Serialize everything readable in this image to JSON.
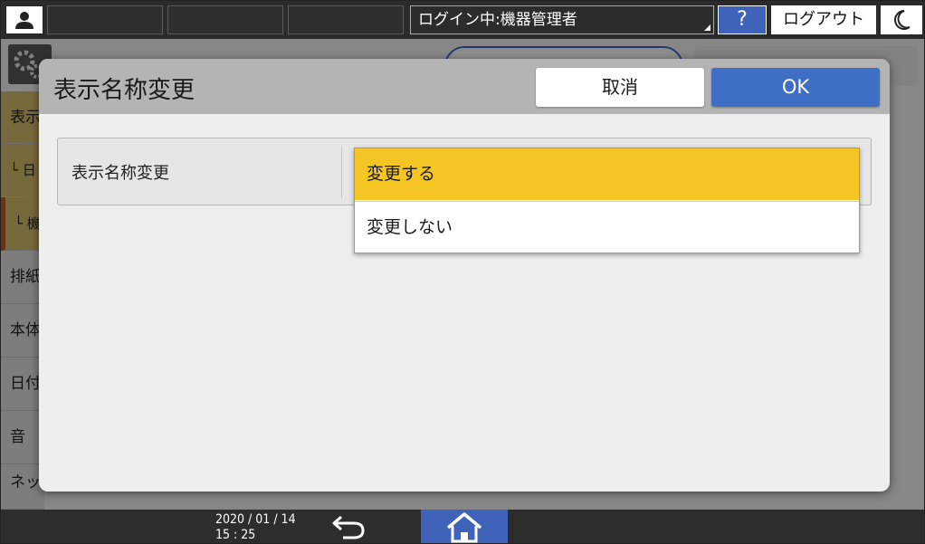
{
  "header": {
    "login_status": "ログイン中:機器管理者",
    "help_label": "?",
    "logout_label": "ログアウト"
  },
  "background": {
    "sidebar_items": [
      "表示",
      "└ 日",
      "└ 機",
      "排紙",
      "本体",
      "日付",
      "音",
      "ネッ"
    ]
  },
  "dialog": {
    "title": "表示名称変更",
    "cancel_label": "取消",
    "ok_label": "OK",
    "setting_label": "表示名称変更",
    "options": [
      "変更する",
      "変更しない"
    ],
    "selected_option": "変更する"
  },
  "footer": {
    "date": "2020 / 01 / 14",
    "time": "15 : 25"
  },
  "colors": {
    "accent_blue": "#3f6fc4",
    "selected_yellow": "#f5c623",
    "topbar": "#2b2b2b"
  }
}
